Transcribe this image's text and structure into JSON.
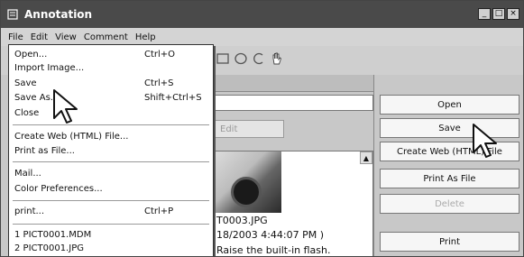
{
  "window": {
    "title": "Annotation",
    "controls": [
      "_",
      "□",
      "×"
    ]
  },
  "menubar": [
    "File",
    "Edit",
    "View",
    "Comment",
    "Help"
  ],
  "file_menu": [
    {
      "label": "Open...",
      "shortcut": "Ctrl+O"
    },
    {
      "label": "Import Image...",
      "shortcut": ""
    },
    {
      "label": "Save",
      "shortcut": "Ctrl+S"
    },
    {
      "label": "Save As...",
      "shortcut": "Shift+Ctrl+S"
    },
    {
      "label": "Close",
      "shortcut": ""
    },
    {
      "label": "Create Web (HTML) File...",
      "shortcut": ""
    },
    {
      "label": "Print as File...",
      "shortcut": ""
    },
    {
      "label": "Mail...",
      "shortcut": ""
    },
    {
      "label": "Color Preferences...",
      "shortcut": ""
    },
    {
      "label": "print...",
      "shortcut": "Ctrl+P"
    },
    {
      "label": "1 PICT0001.MDM",
      "shortcut": ""
    },
    {
      "label": "2 PICT0001.JPG",
      "shortcut": ""
    }
  ],
  "toolbar": {
    "edit_label": "Edit"
  },
  "list": {
    "filename": "T0003.JPG",
    "datetime": "18/2003 4:44:07 PM )",
    "comment": "Raise the built-in flash."
  },
  "right_buttons": [
    {
      "label": "Open",
      "enabled": true
    },
    {
      "label": "Save",
      "enabled": true
    },
    {
      "label": "Create Web (HTML) File",
      "enabled": true
    },
    {
      "label": "Print As File",
      "enabled": true
    },
    {
      "label": "Delete",
      "enabled": false
    },
    {
      "label": "Print",
      "enabled": true
    }
  ]
}
